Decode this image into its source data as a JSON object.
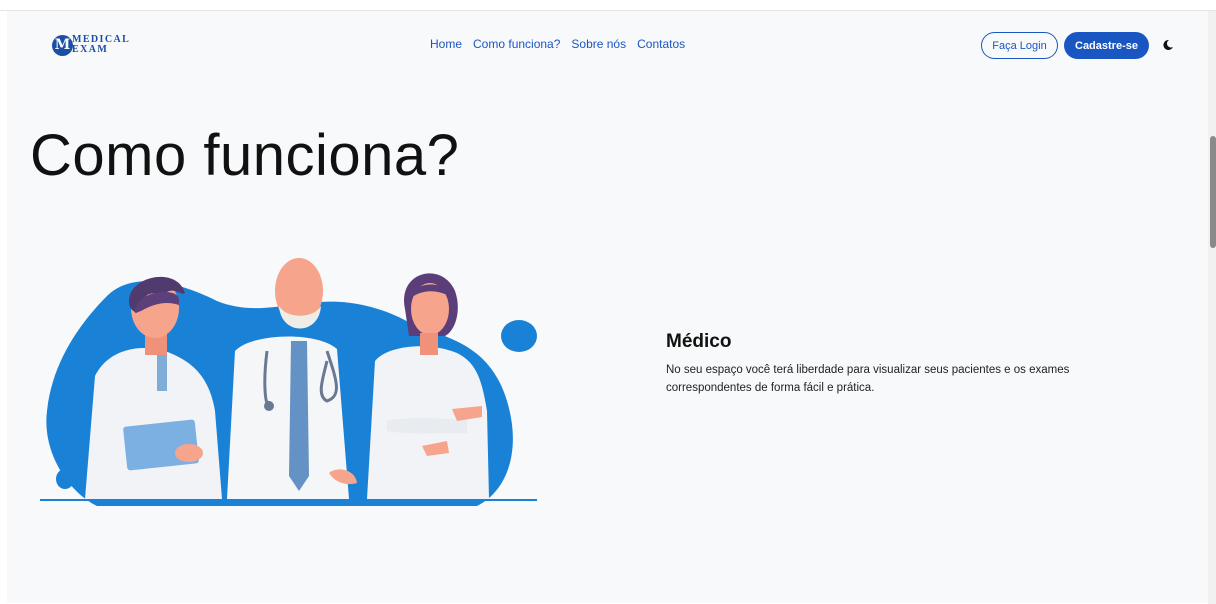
{
  "header": {
    "logo": {
      "badge": "M",
      "line1": "MEDICAL",
      "line2": "EXAM"
    },
    "nav": [
      "Home",
      "Como funciona?",
      "Sobre nós",
      "Contatos"
    ],
    "login_label": "Faça Login",
    "signup_label": "Cadastre-se",
    "theme_icon": "moon-icon"
  },
  "main": {
    "title": "Como funciona?",
    "card": {
      "title": "Médico",
      "text": "No seu espaço você terá liberdade para visualizar seus pacientes e os exames correspondentes de forma fácil e prática."
    }
  },
  "colors": {
    "accent": "#1a56c2",
    "illustration_blue": "#1a82d6",
    "page_bg": "#f8f9fa"
  }
}
